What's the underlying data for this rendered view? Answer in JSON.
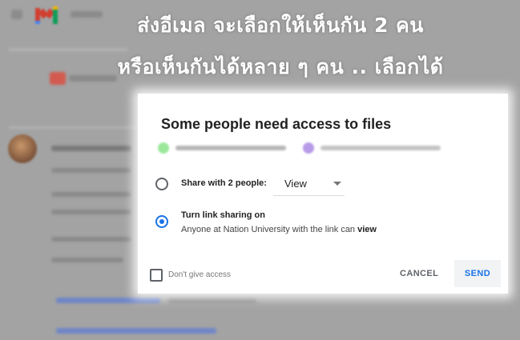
{
  "overlay": {
    "line1": "ส่งอีเมล จะเลือกให้เห็นกัน 2 คน",
    "line2": "หรือเห็นกันได้หลาย ๆ คน .. เลือกได้"
  },
  "dialog": {
    "title": "Some people need access to files",
    "share_label": "Share with 2 people:",
    "permission_value": "View",
    "link_title": "Turn link sharing on",
    "link_desc_prefix": "Anyone at Nation University with the link can ",
    "link_desc_bold": "view",
    "dont_give_label": "Don't give access",
    "cancel_label": "CANCEL",
    "send_label": "SEND",
    "selected_option": "link-sharing"
  },
  "colors": {
    "accent": "#1a73e8",
    "gmail_red": "#d23f31"
  }
}
